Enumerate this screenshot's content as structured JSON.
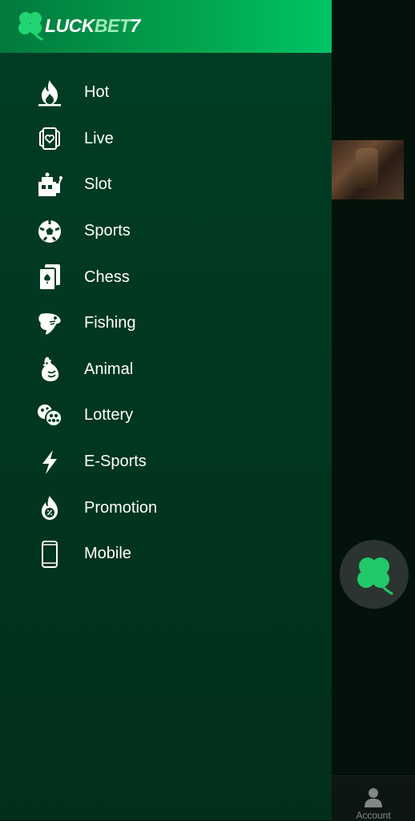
{
  "brand": {
    "name_part1": "LUCK",
    "name_part2": "BET",
    "name_part3": "7"
  },
  "menu": {
    "items": [
      {
        "label": "Hot",
        "icon": "flame-icon"
      },
      {
        "label": "Live",
        "icon": "live-cards-icon"
      },
      {
        "label": "Slot",
        "icon": "slot-machine-icon"
      },
      {
        "label": "Sports",
        "icon": "soccer-ball-icon"
      },
      {
        "label": "Chess",
        "icon": "playing-cards-icon"
      },
      {
        "label": "Fishing",
        "icon": "fish-icon"
      },
      {
        "label": "Animal",
        "icon": "rooster-icon"
      },
      {
        "label": "Lottery",
        "icon": "lottery-balls-icon"
      },
      {
        "label": "E-Sports",
        "icon": "lightning-icon"
      },
      {
        "label": "Promotion",
        "icon": "promotion-flame-icon"
      },
      {
        "label": "Mobile",
        "icon": "mobile-phone-icon"
      }
    ]
  },
  "bottom_nav": {
    "account_label": "Account"
  },
  "colors": {
    "drawer_bg": "#013d24",
    "header_gradient_start": "#027a3e",
    "header_gradient_end": "#00c466",
    "clover": "#22c96a"
  }
}
